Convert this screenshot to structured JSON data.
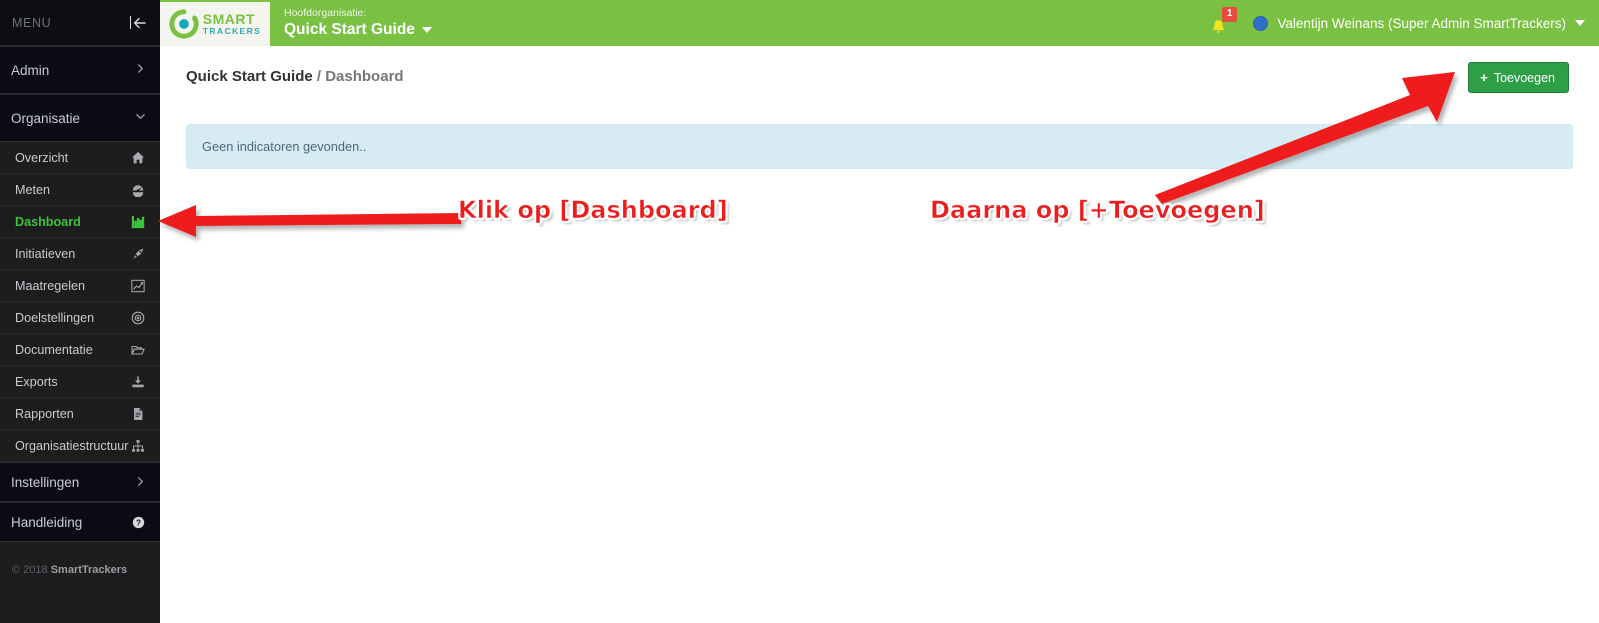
{
  "sidebar": {
    "menu_label": "MENU",
    "collapse_icon": "collapse-left-icon",
    "sections": [
      {
        "label": "Admin",
        "chevron": "chevron-right-icon",
        "expanded": false
      },
      {
        "label": "Organisatie",
        "chevron": "chevron-down-icon",
        "expanded": true
      }
    ],
    "items": [
      {
        "label": "Overzicht",
        "icon": "home-icon",
        "active": false
      },
      {
        "label": "Meten",
        "icon": "gauge-icon",
        "active": false
      },
      {
        "label": "Dashboard",
        "icon": "bar-chart-icon",
        "active": true
      },
      {
        "label": "Initiatieven",
        "icon": "rocket-icon",
        "active": false
      },
      {
        "label": "Maatregelen",
        "icon": "line-chart-icon",
        "active": false
      },
      {
        "label": "Doelstellingen",
        "icon": "bullseye-icon",
        "active": false
      },
      {
        "label": "Documentatie",
        "icon": "folder-open-icon",
        "active": false
      },
      {
        "label": "Exports",
        "icon": "download-icon",
        "active": false
      },
      {
        "label": "Rapporten",
        "icon": "file-icon",
        "active": false
      },
      {
        "label": "Organisatiestructuur",
        "icon": "sitemap-icon",
        "active": false
      }
    ],
    "settings": {
      "label": "Instellingen",
      "chevron": "chevron-right-icon"
    },
    "manual": {
      "label": "Handleiding",
      "icon": "question-circle-icon"
    },
    "copyright_prefix": "© 2018 ",
    "copyright_brand": "SmartTrackers"
  },
  "topbar": {
    "logo": {
      "name": "smarttrackers-logo",
      "line1": "SMART",
      "line2": "TRACKERS"
    },
    "org_label": "Hoofdorganisatie:",
    "org_name": "Quick Start Guide",
    "org_caret": "caret-down-icon",
    "notification": {
      "icon": "bell-icon",
      "count": "1"
    },
    "user": {
      "avatar": "user-avatar",
      "name": "Valentijn Weinans (Super Admin SmartTrackers)",
      "caret": "caret-down-icon"
    }
  },
  "main": {
    "breadcrumb": {
      "root": "Quick Start Guide",
      "separator": " / ",
      "current": "Dashboard"
    },
    "add_button": {
      "plus": "+",
      "label": "Toevoegen",
      "icon": "plus-icon"
    },
    "info_message": "Geen indicatoren gevonden.."
  },
  "annotations": [
    {
      "name": "annotation-klik-dashboard",
      "text": "Klik op [Dashboard]"
    },
    {
      "name": "annotation-daarna-toevoegen",
      "text": "Daarna op [+Toevoegen]"
    }
  ],
  "colors": {
    "brand_green": "#7ac143",
    "accent_teal": "#2aa9b5",
    "button_green": "#2e9e47",
    "active_green": "#3dc33d",
    "info_blue": "#d6ebf4",
    "annotation_red": "#ee1c1c",
    "sidebar_dark": "#1d1d1d",
    "sidebar_section": "#0b0b15"
  }
}
